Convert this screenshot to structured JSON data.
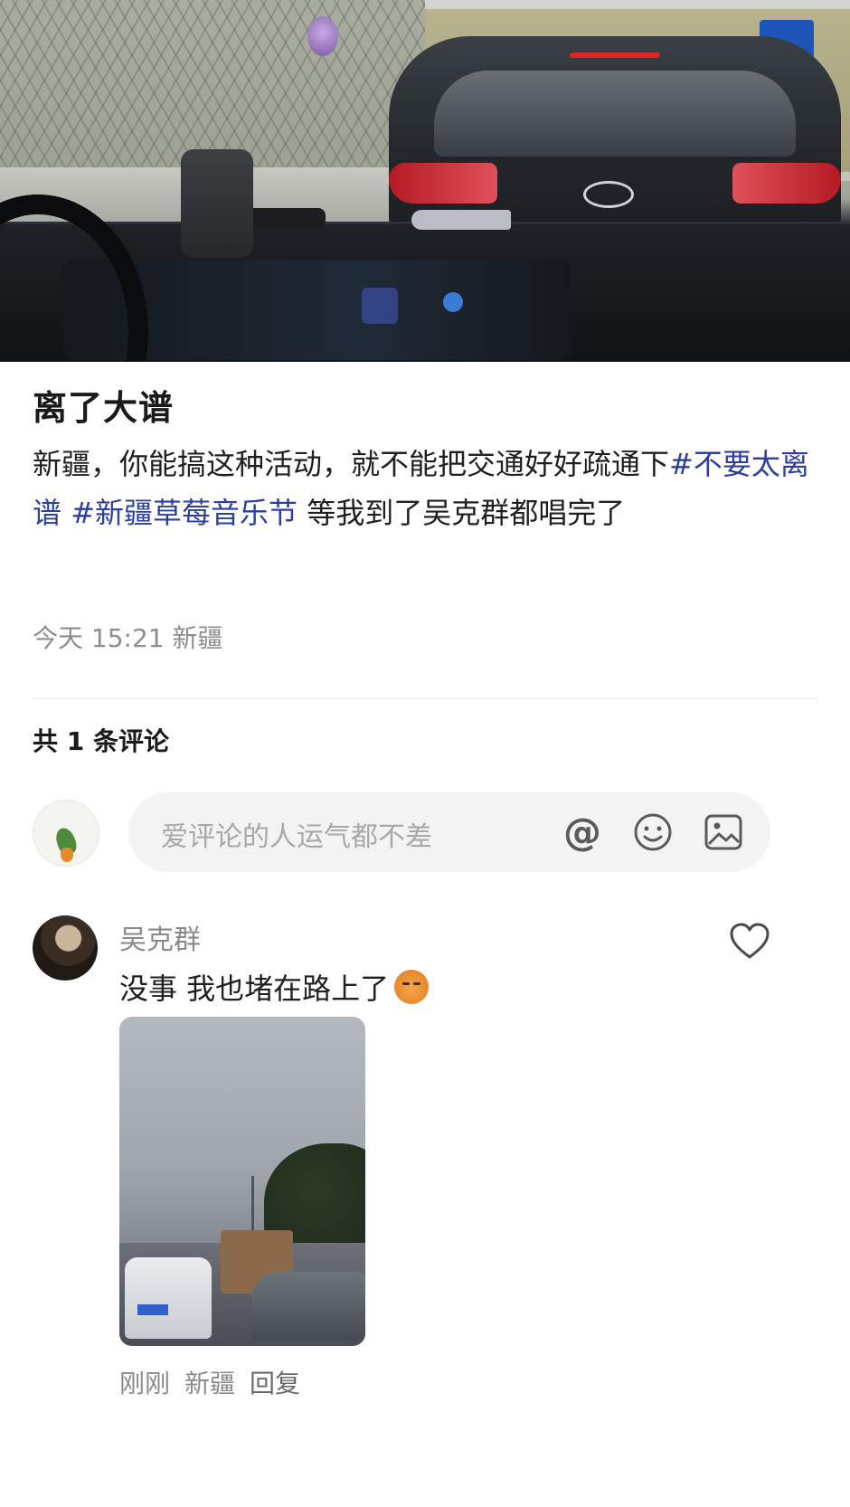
{
  "post": {
    "title": "离了大谱",
    "body_parts": [
      {
        "text": "新疆，你能搞这种活动，就不能把交通好好疏通下",
        "tag": false
      },
      {
        "text": "#不要太离谱",
        "tag": true
      },
      {
        "text": " ",
        "tag": false
      },
      {
        "text": "#新疆草莓音乐节",
        "tag": true
      },
      {
        "text": " 等我到了吴克群都唱完了",
        "tag": false
      }
    ],
    "time": "今天 15:21",
    "location": "新疆"
  },
  "comments_header": {
    "count_label": "共 1 条评论"
  },
  "comment_input": {
    "placeholder": "爱评论的人运气都不差",
    "at_symbol": "@"
  },
  "comment": {
    "author": "吴克群",
    "text": "没事 我也堵在路上了",
    "time": "刚刚",
    "location": "新疆",
    "reply_label": "回复"
  },
  "colors": {
    "hashtag": "#2d3e9e",
    "meta_gray": "#8d8d8d",
    "input_bg": "#f3f3f3"
  },
  "icons": [
    "at-icon",
    "emoji-icon",
    "image-icon",
    "heart-icon"
  ]
}
